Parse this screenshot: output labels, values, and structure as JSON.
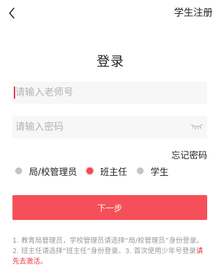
{
  "header": {
    "back_icon": "chevron-left-icon",
    "register_label": "学生注册"
  },
  "page": {
    "title": "登录"
  },
  "form": {
    "teacher_id": {
      "placeholder": "请输入老师号",
      "value": ""
    },
    "password": {
      "placeholder": "请输入密码",
      "value": "",
      "toggle_icon": "eye-closed-icon"
    },
    "forgot_label": "忘记密码"
  },
  "roles": [
    {
      "label": "局/校管理员",
      "selected": false
    },
    {
      "label": "班主任",
      "selected": true
    },
    {
      "label": "学生",
      "selected": false
    }
  ],
  "submit_label": "下一步",
  "note": {
    "text": "1. 教育局管理员，学校管理员请选择“局/校管理员”身份登录。2. 班主任请选择“班主任”身份登录。3. 首次使用少年号登录",
    "activate_link": "请先去激活。"
  },
  "colors": {
    "accent": "#f5505a",
    "link_red": "#e8333e",
    "muted": "#999999"
  }
}
